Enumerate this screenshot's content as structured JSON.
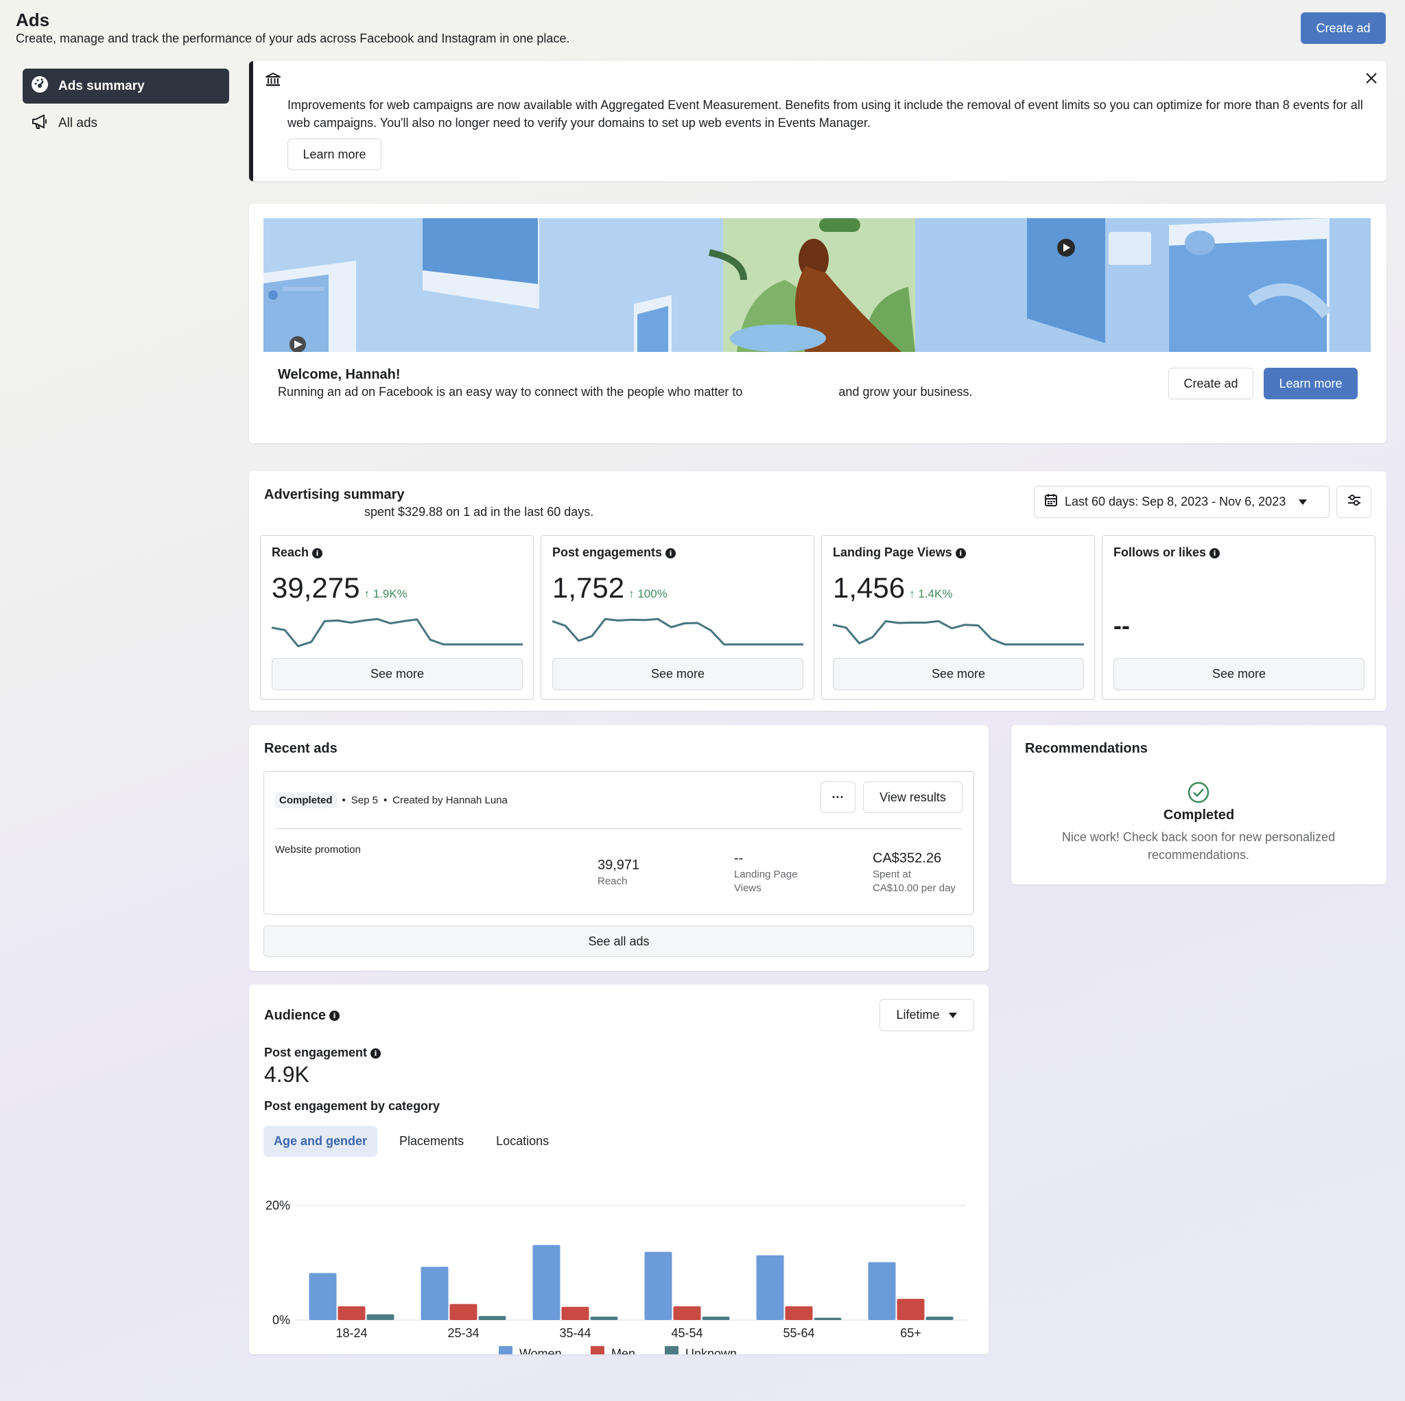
{
  "header": {
    "title": "Ads",
    "subtitle": "Create, manage and track the performance of your ads across Facebook and Instagram in one place.",
    "create_ad_label": "Create ad"
  },
  "sidebar": {
    "items": [
      {
        "label": "Ads summary",
        "icon": "speedometer-icon",
        "active": true
      },
      {
        "label": "All ads",
        "icon": "megaphone-icon",
        "active": false
      }
    ]
  },
  "notice": {
    "icon": "bank-icon",
    "text": "Improvements for web campaigns are now available with Aggregated Event Measurement. Benefits from using it include the removal of event limits so you can optimize for more than 8 events for all web campaigns. You'll also no longer need to verify your domains to set up web events in Events Manager.",
    "learn_more_label": "Learn more"
  },
  "welcome": {
    "title": "Welcome, Hannah!",
    "text_before": "Running an ad on Facebook is an easy way to connect with the people who matter to",
    "text_after": "and grow your business.",
    "create_ad_label": "Create ad",
    "learn_more_label": "Learn more"
  },
  "summary": {
    "title": "Advertising summary",
    "subtitle": "spent $329.88 on 1 ad in the last 60 days.",
    "date_range": "Last 60 days: Sep 8, 2023 - Nov 6, 2023",
    "metrics": [
      {
        "title": "Reach",
        "value": "39,275",
        "delta": "1.9K%",
        "see_more": "See more",
        "spark": [
          0.62,
          0.55,
          0.1,
          0.22,
          0.8,
          0.82,
          0.76,
          0.82,
          0.86,
          0.74,
          0.8,
          0.85,
          0.28,
          0.15,
          0.15,
          0.15,
          0.15,
          0.15,
          0.15,
          0.15
        ]
      },
      {
        "title": "Post engagements",
        "value": "1,752",
        "delta": "100%",
        "see_more": "See more",
        "spark": [
          0.8,
          0.67,
          0.25,
          0.38,
          0.86,
          0.82,
          0.84,
          0.83,
          0.86,
          0.63,
          0.74,
          0.75,
          0.54,
          0.15,
          0.15,
          0.15,
          0.15,
          0.15,
          0.15,
          0.15
        ]
      },
      {
        "title": "Landing Page Views",
        "value": "1,456",
        "delta": "1.4K%",
        "see_more": "See more",
        "spark": [
          0.7,
          0.62,
          0.18,
          0.35,
          0.8,
          0.75,
          0.76,
          0.76,
          0.8,
          0.6,
          0.7,
          0.68,
          0.3,
          0.15,
          0.15,
          0.15,
          0.15,
          0.15,
          0.15,
          0.15
        ]
      },
      {
        "title": "Follows or likes",
        "value": "--",
        "delta": "",
        "see_more": "See more",
        "spark": []
      }
    ]
  },
  "recent_ads": {
    "title": "Recent ads",
    "status": "Completed",
    "date": "Sep 5",
    "created_by": "Created by Hannah Luna",
    "view_results_label": "View results",
    "more_label": "···",
    "ad_name": "Website promotion",
    "reach_value": "39,971",
    "reach_label": "Reach",
    "lpv_value": "--",
    "lpv_label_1": "Landing Page",
    "lpv_label_2": "Views",
    "spent_value": "CA$352.26",
    "spent_label_1": "Spent at",
    "spent_label_2": "CA$10.00 per day",
    "see_all_label": "See all ads"
  },
  "recommendations": {
    "title": "Recommendations",
    "status": "Completed",
    "text": "Nice work! Check back soon for new personalized recommendations."
  },
  "audience": {
    "title": "Audience",
    "period": "Lifetime",
    "metric_label": "Post engagement",
    "metric_value": "4.9K",
    "by_category_label": "Post engagement by category",
    "tabs": [
      "Age and gender",
      "Placements",
      "Locations"
    ]
  },
  "colors": {
    "primary": "#4a77c0",
    "women": "#6b9bd8",
    "men": "#c94a43",
    "unknown": "#4c7b83",
    "sparkline": "#47757f"
  },
  "chart_data": {
    "type": "bar",
    "categories": [
      "18-24",
      "25-34",
      "35-44",
      "45-54",
      "55-64",
      "65+"
    ],
    "series": [
      {
        "name": "Women",
        "values": [
          8.2,
          9.3,
          13.1,
          11.9,
          11.3,
          10.1
        ]
      },
      {
        "name": "Men",
        "values": [
          2.4,
          2.8,
          2.3,
          2.4,
          2.4,
          3.7
        ]
      },
      {
        "name": "Unknown",
        "values": [
          1.0,
          0.7,
          0.6,
          0.6,
          0.4,
          0.6
        ]
      }
    ],
    "ytick_labels": [
      "0%",
      "20%"
    ],
    "ylim": [
      0,
      20
    ],
    "legend": "bottom",
    "grid": true
  }
}
